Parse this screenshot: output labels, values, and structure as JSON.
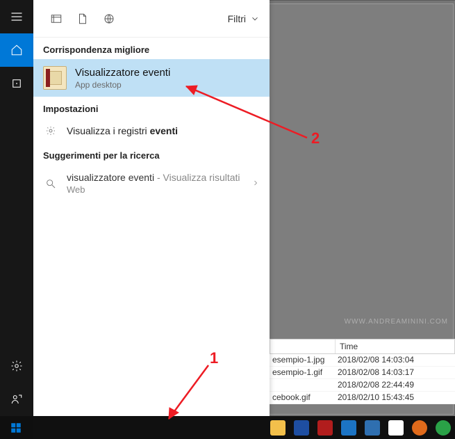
{
  "panel": {
    "filters_label": "Filtri",
    "best_match_header": "Corrispondenza migliore",
    "best_match": {
      "title": "Visualizzatore eventi",
      "subtitle": "App desktop"
    },
    "settings_header": "Impostazioni",
    "settings_item_prefix": "Visualizza i registri ",
    "settings_item_bold": "eventi",
    "suggestions_header": "Suggerimenti per la ricerca",
    "suggestion": {
      "query": "visualizzatore eventi",
      "suffix": " - Visualizza risultati",
      "line2": "Web"
    }
  },
  "search": {
    "value": "visualizzatore eventi"
  },
  "files": {
    "col_time": "Time",
    "rows": [
      {
        "name": "esempio-1.jpg",
        "time": "2018/02/08 14:03:04"
      },
      {
        "name": "esempio-1.gif",
        "time": "2018/02/08 14:03:17"
      },
      {
        "name": "",
        "time": "2018/02/08 22:44:49"
      },
      {
        "name": "cebook.gif",
        "time": "2018/02/10 15:43:45"
      }
    ]
  },
  "watermark": "WWW.ANDREAMININI.COM",
  "annotations": {
    "one": "1",
    "two": "2"
  },
  "taskbar_icons": [
    {
      "name": "explorer-icon",
      "color": "#f3c04b"
    },
    {
      "name": "thunderbird-icon",
      "color": "#1e4ea1"
    },
    {
      "name": "filezilla-icon",
      "color": "#b11d1d"
    },
    {
      "name": "edge-icon",
      "color": "#1c74c4"
    },
    {
      "name": "notepad-icon",
      "color": "#2f6fb0"
    },
    {
      "name": "app-icon",
      "color": "#ffffff"
    },
    {
      "name": "firefox-icon",
      "color": "#e06a1b"
    },
    {
      "name": "chrome-icon",
      "color": "#2aa147"
    }
  ]
}
